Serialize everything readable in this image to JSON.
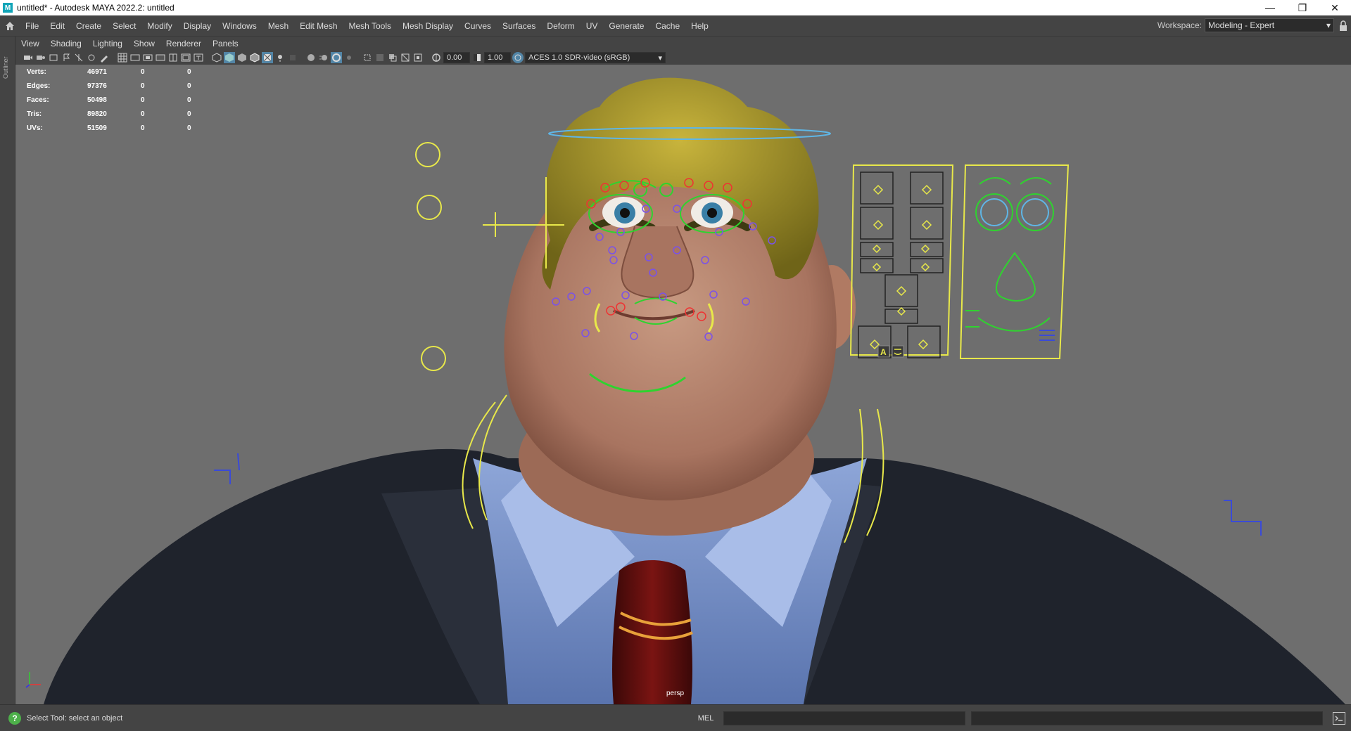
{
  "window": {
    "title": "untitled* - Autodesk MAYA 2022.2: untitled",
    "app_icon": "M"
  },
  "menu": {
    "items": [
      "File",
      "Edit",
      "Create",
      "Select",
      "Modify",
      "Display",
      "Windows",
      "Mesh",
      "Edit Mesh",
      "Mesh Tools",
      "Mesh Display",
      "Curves",
      "Surfaces",
      "Deform",
      "UV",
      "Generate",
      "Cache",
      "Help"
    ]
  },
  "workspace": {
    "label": "Workspace:",
    "value": "Modeling - Expert"
  },
  "outliner": {
    "label": "Outliner"
  },
  "panel_menu": {
    "items": [
      "View",
      "Shading",
      "Lighting",
      "Show",
      "Renderer",
      "Panels"
    ]
  },
  "panel_toolbar": {
    "exposure": "0.00",
    "gamma": "1.00",
    "color_space": "ACES 1.0 SDR-video (sRGB)"
  },
  "hud": {
    "rows": [
      {
        "label": "Verts:",
        "value": "46971",
        "sel": "0",
        "comp": "0"
      },
      {
        "label": "Edges:",
        "value": "97376",
        "sel": "0",
        "comp": "0"
      },
      {
        "label": "Faces:",
        "value": "50498",
        "sel": "0",
        "comp": "0"
      },
      {
        "label": "Tris:",
        "value": "89820",
        "sel": "0",
        "comp": "0"
      },
      {
        "label": "UVs:",
        "value": "51509",
        "sel": "0",
        "comp": "0"
      }
    ]
  },
  "viewport": {
    "camera": "persp",
    "face_panel_button_a": "A"
  },
  "status": {
    "text": "Select Tool: select an object",
    "mel": "MEL"
  }
}
